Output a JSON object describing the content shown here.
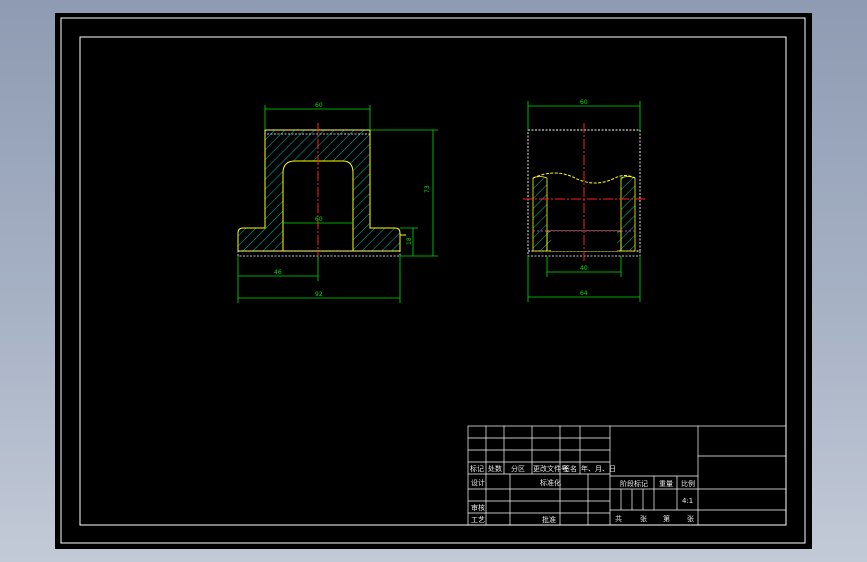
{
  "drawing": {
    "background_color": "#000000",
    "frame_color": "#ffffff",
    "outline_color": "#ffff00",
    "dimension_color": "#00ff00",
    "centerline_color": "#ff0000",
    "hatch_color": "#00cccc",
    "left_view": {
      "dims": {
        "top_width": "60",
        "inner_width": "60",
        "height": "73",
        "flange_height": "18",
        "half_base": "46",
        "base_width": "92"
      }
    },
    "right_view": {
      "dims": {
        "top_width": "60",
        "inner_width": "40",
        "base_width": "64"
      }
    }
  },
  "title_block": {
    "headers": [
      "标记",
      "处数",
      "分区",
      "更改文件号",
      "签名",
      "年、月、日"
    ],
    "labels": {
      "design": "设计",
      "standardization": "标准化",
      "review": "审核",
      "process": "工艺",
      "approve": "批准",
      "stage_mark": "阶段标记",
      "weight": "重量",
      "scale": "比例",
      "scale_value": "4:1",
      "total": "共",
      "sheet_unit_1": "张",
      "page": "第",
      "sheet_unit_2": "张"
    }
  }
}
